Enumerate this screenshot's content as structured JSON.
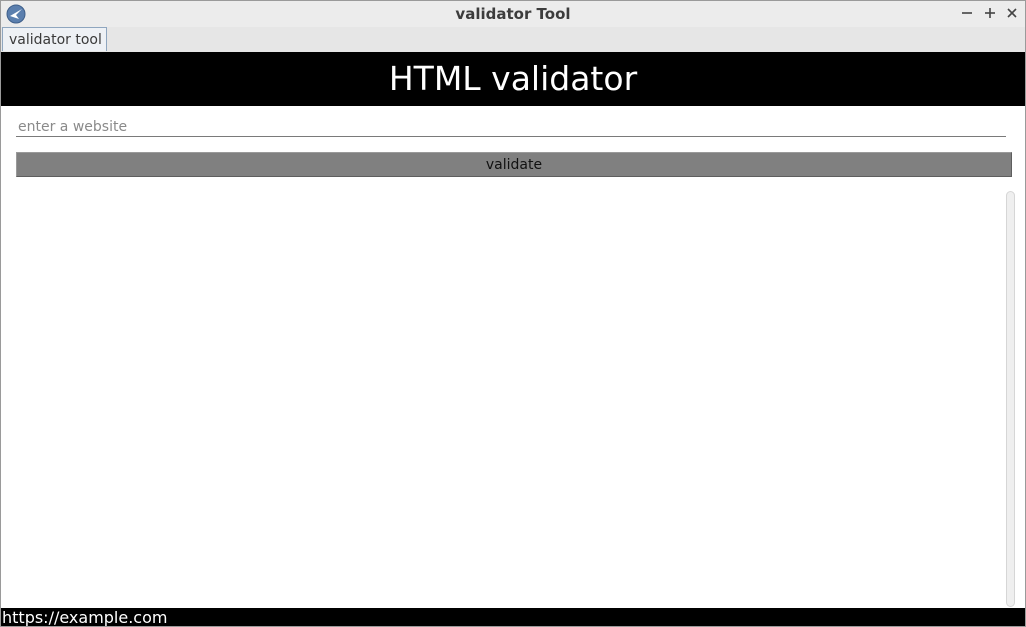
{
  "window": {
    "title": "validator Tool",
    "app_icon": "app-logo-icon",
    "controls": {
      "minimize_icon": "minimize-icon",
      "maximize_icon": "maximize-icon",
      "close_icon": "close-icon"
    }
  },
  "tabs": [
    {
      "label": "validator tool",
      "active": true
    }
  ],
  "header": {
    "title": "HTML validator"
  },
  "form": {
    "url_input": {
      "value": "",
      "placeholder": "enter a website"
    },
    "validate_label": "validate"
  },
  "output": {
    "text": ""
  },
  "statusbar": {
    "text": "https://example.com"
  },
  "colors": {
    "banner_bg": "#000000",
    "banner_text": "#ffffff",
    "button_bg": "#808080",
    "statusbar_bg": "#000000"
  }
}
